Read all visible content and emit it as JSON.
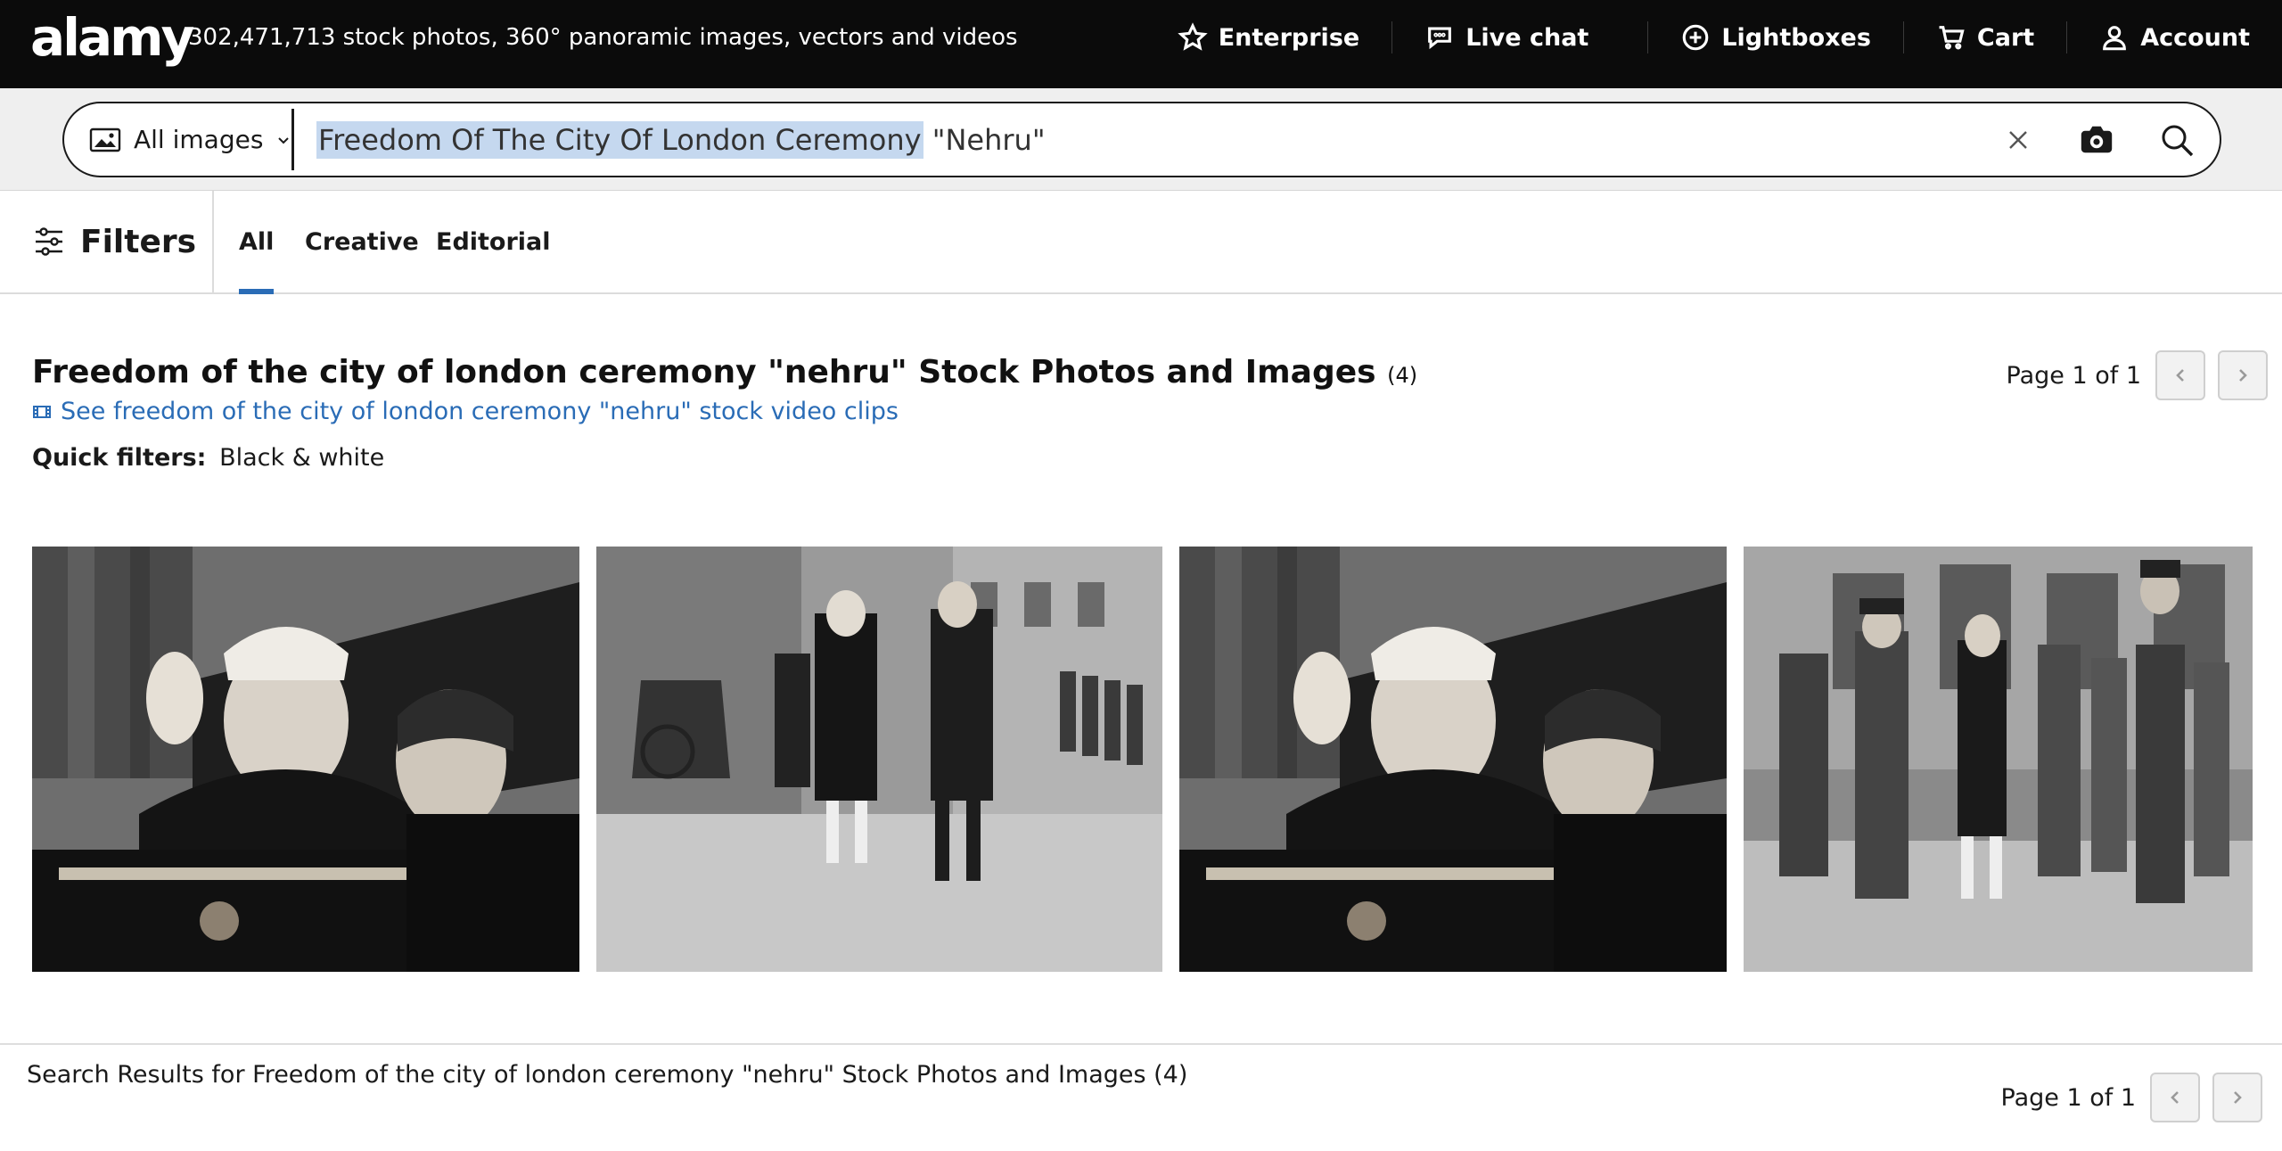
{
  "topbar": {
    "logo": "alamy",
    "tagline": "302,471,713 stock photos, 360° panoramic images, vectors and videos",
    "nav": [
      {
        "label": "Enterprise",
        "icon": "star-icon"
      },
      {
        "label": "Live chat",
        "icon": "chat-icon"
      },
      {
        "label": "Lightboxes",
        "icon": "plus-circle-icon"
      },
      {
        "label": "Cart",
        "icon": "cart-icon"
      },
      {
        "label": "Account",
        "icon": "user-icon"
      }
    ]
  },
  "search": {
    "scope_label": "All images",
    "query_selected": "Freedom Of The City Of London Ceremony",
    "query_rest": " \"Nehru\""
  },
  "tabbar": {
    "filters_label": "Filters",
    "tabs": [
      {
        "label": "All",
        "active": true
      },
      {
        "label": "Creative",
        "active": false
      },
      {
        "label": "Editorial",
        "active": false
      }
    ]
  },
  "results": {
    "title": "Freedom of the city of london ceremony \"nehru\" Stock Photos and Images",
    "count": "(4)",
    "video_link": "See freedom of the city of london ceremony \"nehru\" stock video clips",
    "quick_filters_label": "Quick filters:",
    "quick_filters_value": "Black & white",
    "pager_top": "Page 1 of 1",
    "pager_bottom": "Page 1 of 1",
    "footer": "Search Results for Freedom of the city of london ceremony \"nehru\" Stock Photos and Images (4)"
  },
  "colors": {
    "topbar_bg": "#0b0b0b",
    "link": "#2a6cb6",
    "active_tab": "#2a6cb6",
    "selection": "#c5d8ef"
  }
}
